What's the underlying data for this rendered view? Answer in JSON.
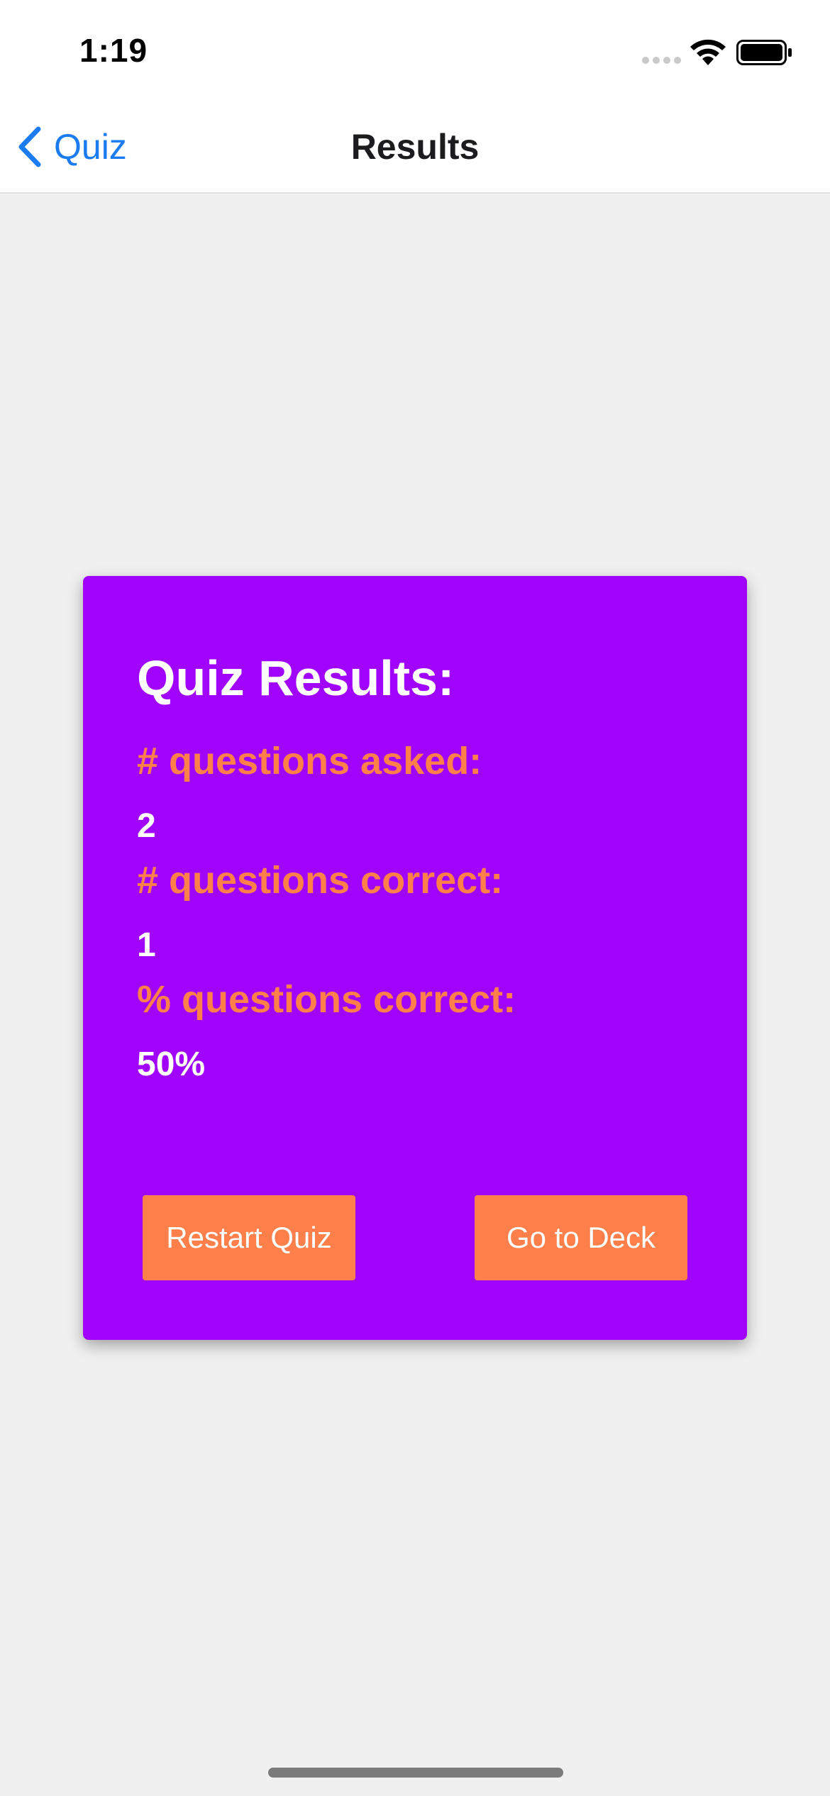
{
  "status_bar": {
    "time": "1:19"
  },
  "nav": {
    "back_label": "Quiz",
    "title": "Results"
  },
  "card": {
    "title": "Quiz Results:",
    "stats": [
      {
        "label": "# questions asked:",
        "value": "2"
      },
      {
        "label": "# questions correct:",
        "value": "1"
      },
      {
        "label": "% questions correct:",
        "value": "50%"
      }
    ],
    "buttons": {
      "restart_label": "Restart Quiz",
      "deck_label": "Go to Deck"
    }
  },
  "colors": {
    "card_background": "#a004fc",
    "accent_orange": "#ff7f4a",
    "link_blue": "#1a7cf0",
    "page_background": "#f0f0f0"
  },
  "icons": {
    "back": "chevron-left-icon",
    "wifi": "wifi-icon",
    "battery": "battery-icon",
    "signal": "cellular-signal-icon"
  }
}
